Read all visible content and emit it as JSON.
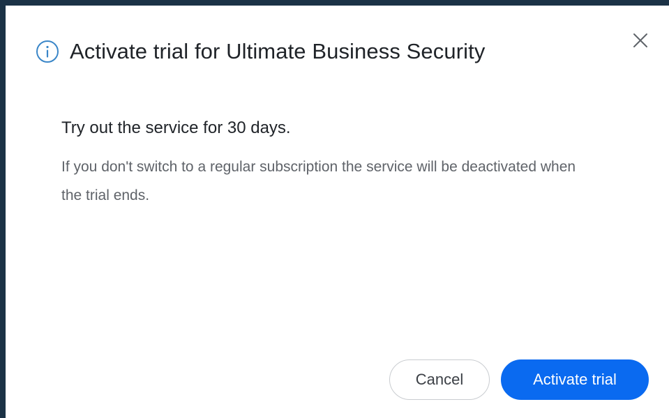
{
  "dialog": {
    "title": "Activate trial for Ultimate Business Security",
    "info_icon": "info-circle-icon",
    "close_icon": "close-icon",
    "subtitle": "Try out the service for 30 days.",
    "body": "If you don't switch to a regular subscription the service will be deactivated when the trial ends.",
    "cancel_label": "Cancel",
    "activate_label": "Activate trial"
  },
  "colors": {
    "backdrop": "#1b3246",
    "primary": "#0a6af0",
    "info_icon": "#3a86c8"
  }
}
